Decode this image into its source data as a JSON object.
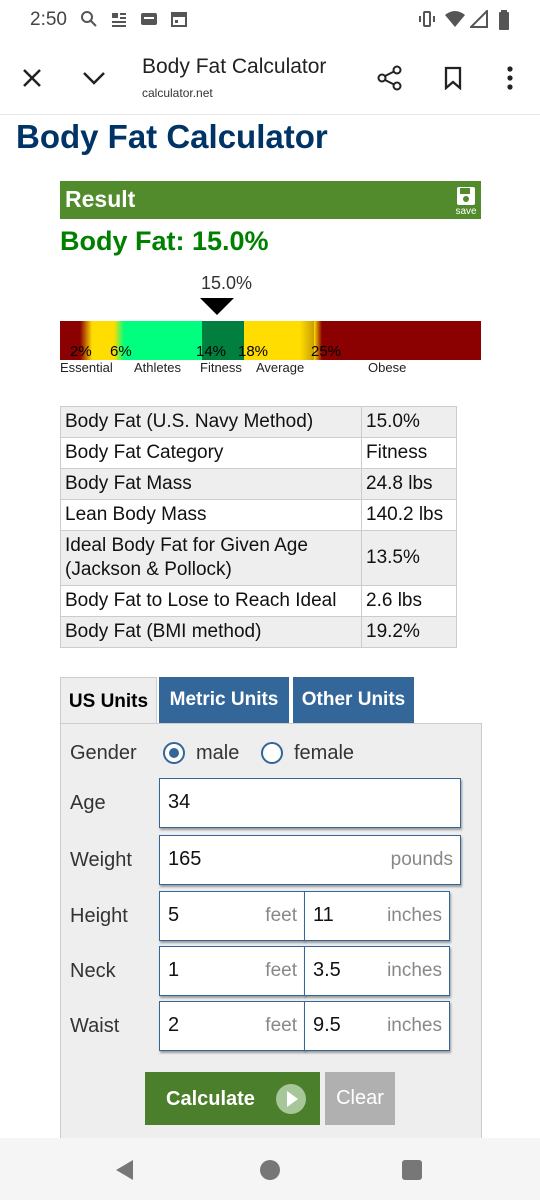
{
  "status_bar": {
    "time": "2:50"
  },
  "browser": {
    "title": "Body Fat Calculator",
    "url": "calculator.net"
  },
  "page": {
    "heading": "Body Fat Calculator",
    "result": {
      "header": "Result",
      "save_label": "save",
      "headline": "Body Fat: 15.0%",
      "marker_value": "15.0%",
      "marker_percent": 15.0
    },
    "scale": {
      "ticks": [
        "2%",
        "6%",
        "14%",
        "18%",
        "25%"
      ],
      "categories": [
        "Essential",
        "Athletes",
        "Fitness",
        "Average",
        "Obese"
      ],
      "colors": {
        "dark_red": "#8b0000",
        "yellow": "#ffdd00",
        "light_green": "#00ff7f",
        "dark_green": "#007f3f"
      }
    },
    "table": [
      {
        "label": "Body Fat (U.S. Navy Method)",
        "value": "15.0%"
      },
      {
        "label": "Body Fat Category",
        "value": "Fitness"
      },
      {
        "label": "Body Fat Mass",
        "value": "24.8 lbs"
      },
      {
        "label": "Lean Body Mass",
        "value": "140.2 lbs"
      },
      {
        "label": "Ideal Body Fat for Given Age (Jackson & Pollock)",
        "value": "13.5%"
      },
      {
        "label": "Body Fat to Lose to Reach Ideal",
        "value": "2.6 lbs"
      },
      {
        "label": "Body Fat (BMI method)",
        "value": "19.2%"
      }
    ],
    "tabs": [
      "US Units",
      "Metric Units",
      "Other Units"
    ],
    "form": {
      "gender_label": "Gender",
      "gender_male": "male",
      "gender_female": "female",
      "gender_selected": "male",
      "age_label": "Age",
      "age_value": "34",
      "weight_label": "Weight",
      "weight_value": "165",
      "weight_unit": "pounds",
      "height_label": "Height",
      "height_feet": "5",
      "height_inches": "11",
      "neck_label": "Neck",
      "neck_feet": "1",
      "neck_inches": "3.5",
      "waist_label": "Waist",
      "waist_feet": "2",
      "waist_inches": "9.5",
      "feet_unit": "feet",
      "inches_unit": "inches"
    },
    "buttons": {
      "calculate": "Calculate",
      "clear": "Clear"
    }
  },
  "colors": {
    "heading": "#003366",
    "result_green": "#518b2c",
    "headline_green": "#008000",
    "tab_blue": "#336699"
  }
}
